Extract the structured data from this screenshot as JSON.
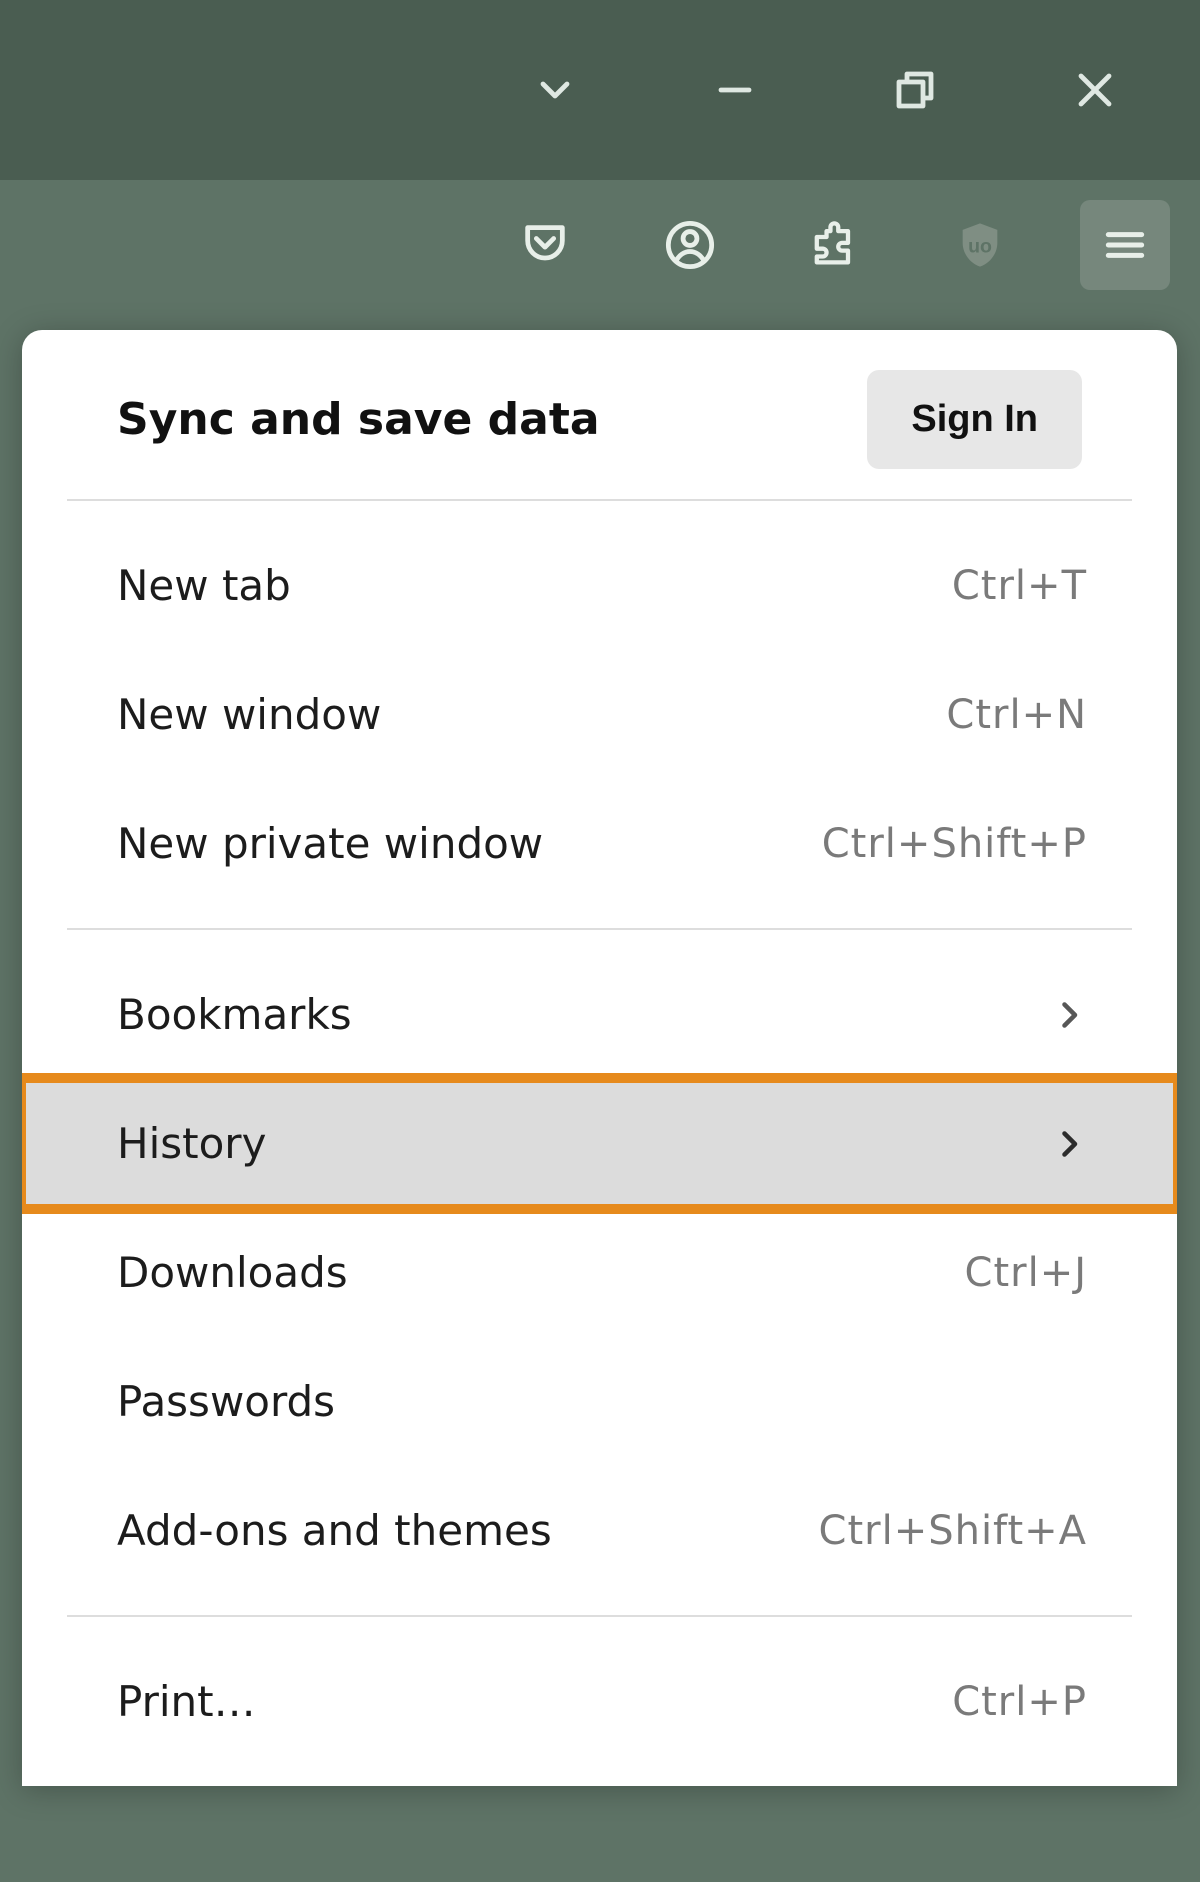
{
  "sync": {
    "title": "Sync and save data",
    "button": "Sign In"
  },
  "sections": [
    {
      "items": [
        {
          "label": "New tab",
          "shortcut": "Ctrl+T"
        },
        {
          "label": "New window",
          "shortcut": "Ctrl+N"
        },
        {
          "label": "New private window",
          "shortcut": "Ctrl+Shift+P"
        }
      ]
    },
    {
      "items": [
        {
          "label": "Bookmarks",
          "submenu": true
        },
        {
          "label": "History",
          "submenu": true,
          "hovered": true,
          "highlight": true
        },
        {
          "label": "Downloads",
          "shortcut": "Ctrl+J"
        },
        {
          "label": "Passwords"
        },
        {
          "label": "Add-ons and themes",
          "shortcut": "Ctrl+Shift+A"
        }
      ]
    },
    {
      "items": [
        {
          "label": "Print…",
          "shortcut": "Ctrl+P"
        }
      ]
    }
  ]
}
